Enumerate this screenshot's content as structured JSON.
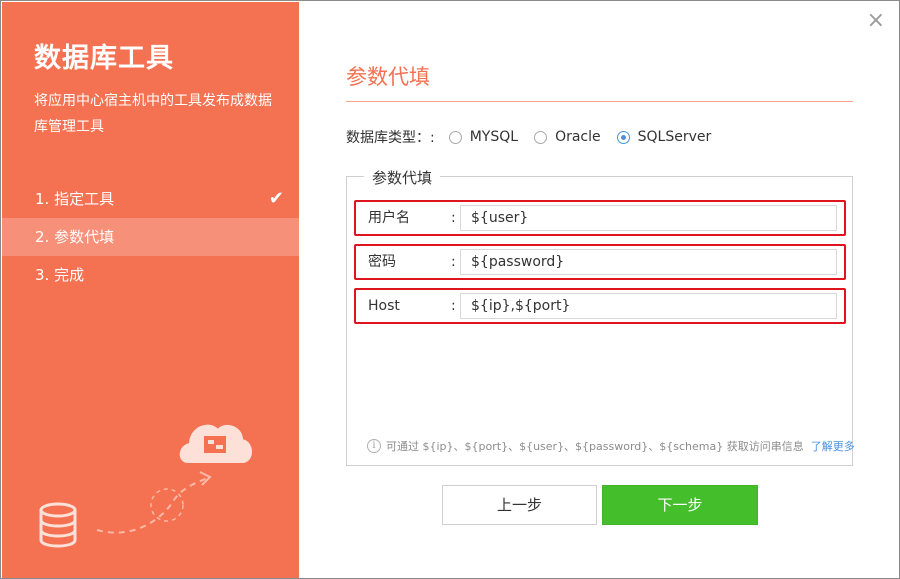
{
  "sidebar": {
    "title": "数据库工具",
    "description": "将应用中心宿主机中的工具发布成数据库管理工具",
    "steps": [
      {
        "label": "1. 指定工具",
        "done": true
      },
      {
        "label": "2. 参数代填",
        "active": true
      },
      {
        "label": "3. 完成"
      }
    ],
    "bg_color": "#f47152"
  },
  "close_icon": "×",
  "main": {
    "section_title": "参数代填",
    "db_type": {
      "label": "数据库类型：:",
      "options": [
        "MYSQL",
        "Oracle",
        "SQLServer"
      ],
      "selected": "SQLServer"
    },
    "params_group": {
      "legend": "参数代填",
      "fields": [
        {
          "label": "用户名",
          "colon": ":",
          "value": "${user}"
        },
        {
          "label": "密码",
          "colon": ":",
          "value": "${password}"
        },
        {
          "label": "Host",
          "colon": ":",
          "value": "${ip},${port}"
        }
      ]
    },
    "hint": {
      "icon": "info-icon",
      "text": "可通过 ${ip}、${port}、${user}、${password}、${schema} 获取访问串信息",
      "link": "了解更多"
    },
    "buttons": {
      "prev": "上一步",
      "next": "下一步"
    }
  },
  "colors": {
    "accent": "#f47152",
    "highlight": "#e0141e",
    "primary_button": "#45be2c",
    "link": "#4a90e2"
  }
}
